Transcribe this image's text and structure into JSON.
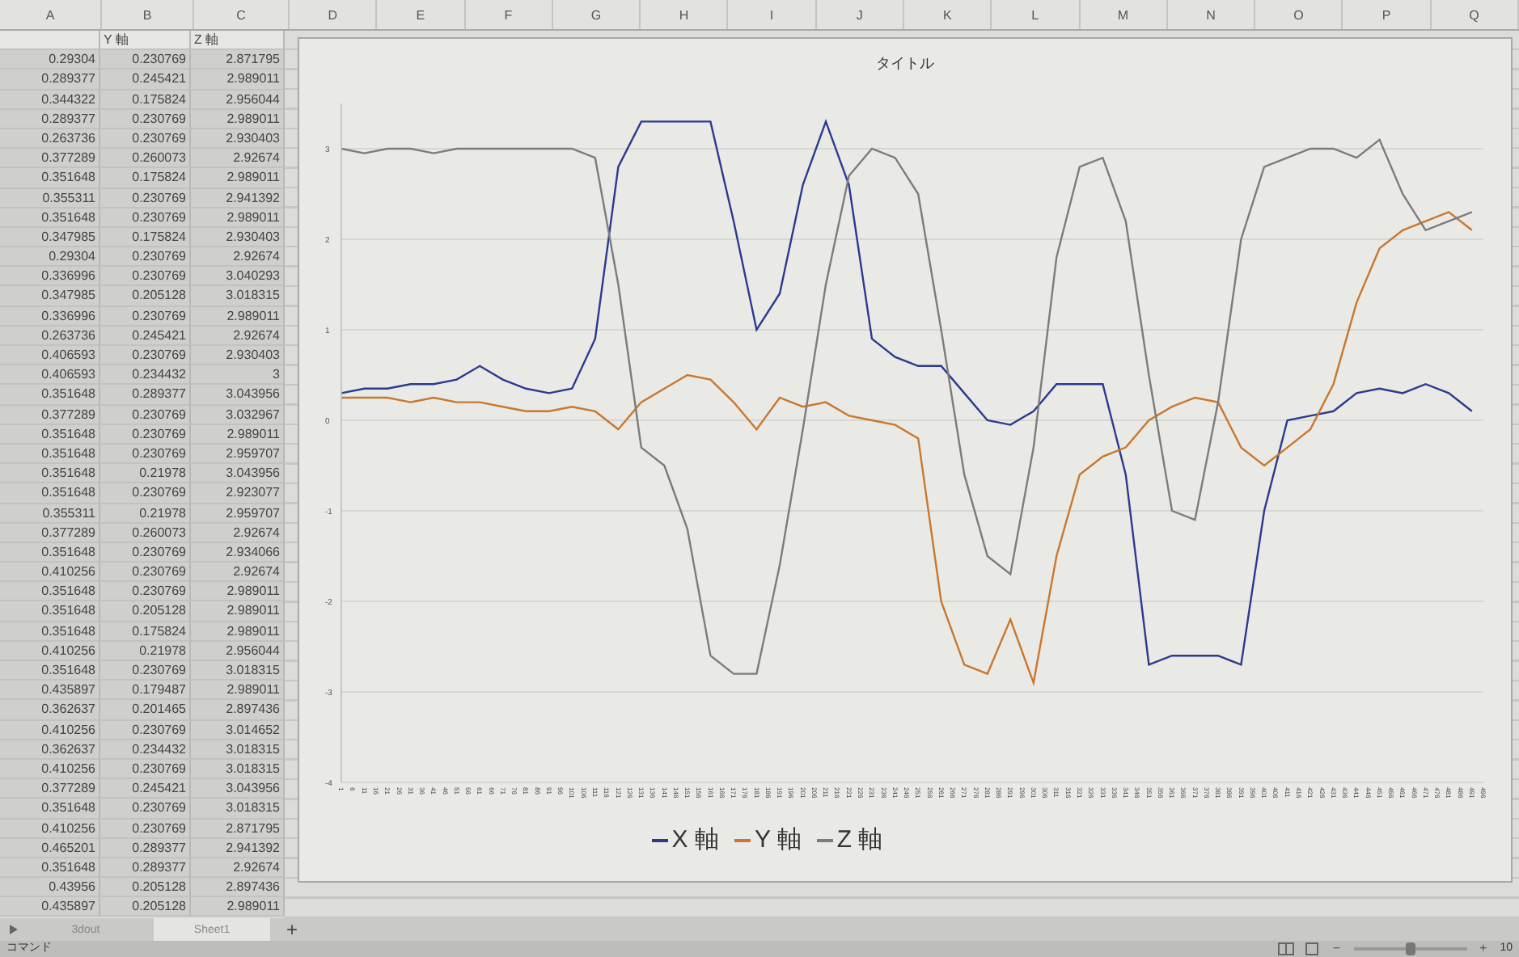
{
  "column_letters": [
    "A",
    "B",
    "C",
    "D",
    "E",
    "F",
    "G",
    "H",
    "I",
    "J",
    "K",
    "L",
    "M",
    "N",
    "O",
    "P",
    "Q"
  ],
  "table": {
    "header_row": [
      "Y 軸",
      "Z 軸"
    ],
    "rows": [
      [
        "0.29304",
        "0.230769",
        "2.871795"
      ],
      [
        "0.289377",
        "0.245421",
        "2.989011"
      ],
      [
        "0.344322",
        "0.175824",
        "2.956044"
      ],
      [
        "0.289377",
        "0.230769",
        "2.989011"
      ],
      [
        "0.263736",
        "0.230769",
        "2.930403"
      ],
      [
        "0.377289",
        "0.260073",
        "2.92674"
      ],
      [
        "0.351648",
        "0.175824",
        "2.989011"
      ],
      [
        "0.355311",
        "0.230769",
        "2.941392"
      ],
      [
        "0.351648",
        "0.230769",
        "2.989011"
      ],
      [
        "0.347985",
        "0.175824",
        "2.930403"
      ],
      [
        "0.29304",
        "0.230769",
        "2.92674"
      ],
      [
        "0.336996",
        "0.230769",
        "3.040293"
      ],
      [
        "0.347985",
        "0.205128",
        "3.018315"
      ],
      [
        "0.336996",
        "0.230769",
        "2.989011"
      ],
      [
        "0.263736",
        "0.245421",
        "2.92674"
      ],
      [
        "0.406593",
        "0.230769",
        "2.930403"
      ],
      [
        "0.406593",
        "0.234432",
        "3"
      ],
      [
        "0.351648",
        "0.289377",
        "3.043956"
      ],
      [
        "0.377289",
        "0.230769",
        "3.032967"
      ],
      [
        "0.351648",
        "0.230769",
        "2.989011"
      ],
      [
        "0.351648",
        "0.230769",
        "2.959707"
      ],
      [
        "0.351648",
        "0.21978",
        "3.043956"
      ],
      [
        "0.351648",
        "0.230769",
        "2.923077"
      ],
      [
        "0.355311",
        "0.21978",
        "2.959707"
      ],
      [
        "0.377289",
        "0.260073",
        "2.92674"
      ],
      [
        "0.351648",
        "0.230769",
        "2.934066"
      ],
      [
        "0.410256",
        "0.230769",
        "2.92674"
      ],
      [
        "0.351648",
        "0.230769",
        "2.989011"
      ],
      [
        "0.351648",
        "0.205128",
        "2.989011"
      ],
      [
        "0.351648",
        "0.175824",
        "2.989011"
      ],
      [
        "0.410256",
        "0.21978",
        "2.956044"
      ],
      [
        "0.351648",
        "0.230769",
        "3.018315"
      ],
      [
        "0.435897",
        "0.179487",
        "2.989011"
      ],
      [
        "0.362637",
        "0.201465",
        "2.897436"
      ],
      [
        "0.410256",
        "0.230769",
        "3.014652"
      ],
      [
        "0.362637",
        "0.234432",
        "3.018315"
      ],
      [
        "0.410256",
        "0.230769",
        "3.018315"
      ],
      [
        "0.377289",
        "0.245421",
        "3.043956"
      ],
      [
        "0.351648",
        "0.230769",
        "3.018315"
      ],
      [
        "0.410256",
        "0.230769",
        "2.871795"
      ],
      [
        "0.465201",
        "0.289377",
        "2.941392"
      ],
      [
        "0.351648",
        "0.289377",
        "2.92674"
      ],
      [
        "0.43956",
        "0.205128",
        "2.897436"
      ],
      [
        "0.435897",
        "0.205128",
        "2.989011"
      ]
    ]
  },
  "chart": {
    "chart_data": {
      "type": "line",
      "title": "タイトル",
      "x": [
        1,
        11,
        21,
        31,
        41,
        51,
        61,
        71,
        81,
        91,
        101,
        111,
        121,
        131,
        141,
        151,
        161,
        171,
        181,
        191,
        201,
        211,
        221,
        231,
        241,
        251,
        261,
        271,
        281,
        291,
        301,
        311,
        321,
        331,
        341,
        351,
        361,
        371,
        381,
        391,
        401,
        411,
        421,
        431,
        441,
        451,
        461,
        471,
        481,
        491
      ],
      "series": [
        {
          "name": "X 軸",
          "color": "#2b3a8e",
          "values": [
            0.3,
            0.35,
            0.35,
            0.4,
            0.4,
            0.45,
            0.6,
            0.45,
            0.35,
            0.3,
            0.35,
            0.9,
            2.8,
            3.3,
            3.3,
            3.3,
            3.3,
            2.2,
            1.0,
            1.4,
            2.6,
            3.3,
            2.6,
            0.9,
            0.7,
            0.6,
            0.6,
            0.3,
            0.0,
            -0.05,
            0.1,
            0.4,
            0.4,
            0.4,
            -0.6,
            -2.7,
            -2.6,
            -2.6,
            -2.6,
            -2.7,
            -1.0,
            0.0,
            0.05,
            0.1,
            0.3,
            0.35,
            0.3,
            0.4,
            0.3,
            0.1
          ]
        },
        {
          "name": "Y 軸",
          "color": "#c8782e",
          "values": [
            0.25,
            0.25,
            0.25,
            0.2,
            0.25,
            0.2,
            0.2,
            0.15,
            0.1,
            0.1,
            0.15,
            0.1,
            -0.1,
            0.2,
            0.35,
            0.5,
            0.45,
            0.2,
            -0.1,
            0.25,
            0.15,
            0.2,
            0.05,
            0.0,
            -0.05,
            -0.2,
            -2.0,
            -2.7,
            -2.8,
            -2.2,
            -2.9,
            -1.5,
            -0.6,
            -0.4,
            -0.3,
            0.0,
            0.15,
            0.25,
            0.2,
            -0.3,
            -0.5,
            -0.3,
            -0.1,
            0.4,
            1.3,
            1.9,
            2.1,
            2.2,
            2.3,
            2.1
          ]
        },
        {
          "name": "Z 軸",
          "color": "#7c7c7c",
          "values": [
            3.0,
            2.95,
            3.0,
            3.0,
            2.95,
            3.0,
            3.0,
            3.0,
            3.0,
            3.0,
            3.0,
            2.9,
            1.5,
            -0.3,
            -0.5,
            -1.2,
            -2.6,
            -2.8,
            -2.8,
            -1.6,
            -0.1,
            1.5,
            2.7,
            3.0,
            2.9,
            2.5,
            1.0,
            -0.6,
            -1.5,
            -1.7,
            -0.3,
            1.8,
            2.8,
            2.9,
            2.2,
            0.5,
            -1.0,
            -1.1,
            0.2,
            2.0,
            2.8,
            2.9,
            3.0,
            3.0,
            2.9,
            3.1,
            2.5,
            2.1,
            2.2,
            2.3
          ]
        }
      ],
      "xlim": [
        1,
        496
      ],
      "ylim": [
        -4,
        3.5
      ],
      "grid": true,
      "xticks": [
        1,
        6,
        11,
        16,
        21,
        26,
        31,
        36,
        41,
        46,
        51,
        56,
        61,
        66,
        71,
        76,
        81,
        86,
        91,
        96,
        101,
        106,
        111,
        116,
        121,
        126,
        131,
        136,
        141,
        146,
        151,
        156,
        161,
        166,
        171,
        176,
        181,
        186,
        191,
        196,
        201,
        206,
        211,
        216,
        221,
        226,
        231,
        236,
        241,
        246,
        251,
        256,
        261,
        266,
        271,
        276,
        281,
        286,
        291,
        296,
        301,
        306,
        311,
        316,
        321,
        326,
        331,
        336,
        341,
        346,
        351,
        356,
        361,
        366,
        371,
        376,
        381,
        386,
        391,
        396,
        401,
        406,
        411,
        416,
        421,
        426,
        431,
        436,
        441,
        446,
        451,
        456,
        461,
        466,
        471,
        476,
        481,
        486,
        491,
        496
      ],
      "yticks": [
        -4,
        -3,
        -2,
        -1,
        0,
        1,
        2,
        3
      ]
    }
  },
  "sheet_tabs": [
    {
      "label": "3dout",
      "selected": false
    },
    {
      "label": "Sheet1",
      "selected": true
    }
  ],
  "add_sheet": "+",
  "status_bar": {
    "mode": "コマンド",
    "zoom": {
      "minus": "−",
      "plus": "+",
      "level": 0.5,
      "reading": "10"
    }
  }
}
